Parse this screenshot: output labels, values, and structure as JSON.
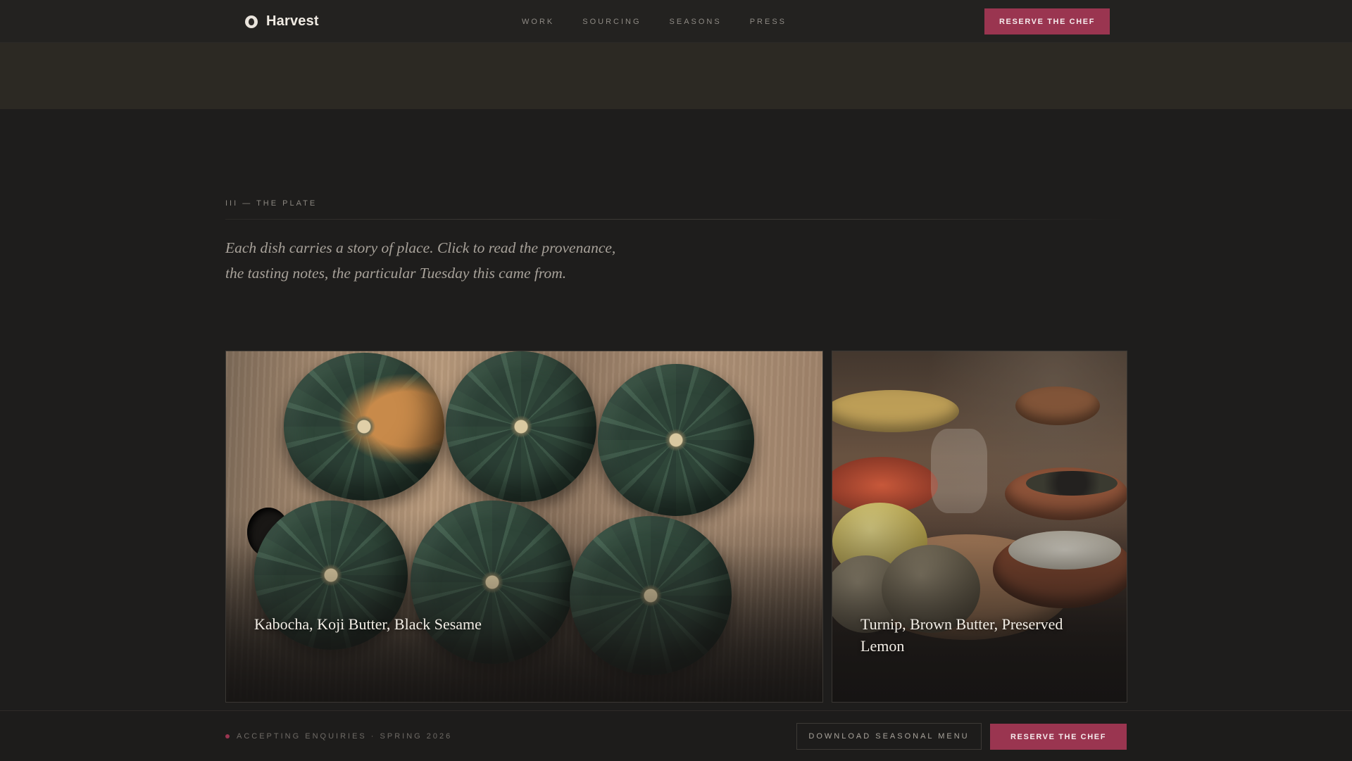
{
  "brand": {
    "name": "Harvest",
    "logo_icon": "globe-seal-icon"
  },
  "nav": {
    "items": [
      {
        "label": "WORK"
      },
      {
        "label": "SOURCING"
      },
      {
        "label": "SEASONS"
      },
      {
        "label": "PRESS"
      }
    ],
    "cta_label": "RESERVE THE CHEF"
  },
  "section": {
    "eyebrow": "III — THE PLATE",
    "intro": "Each dish carries a story of place. Click to read the provenance, the tasting notes, the particular Tuesday this came from."
  },
  "dishes": [
    {
      "title": "Kabocha, Koji Butter, Black Sesame",
      "photo": "kabocha squashes on a wooden board"
    },
    {
      "title": "Turnip, Brown Butter, Preserved Lemon",
      "photo": "turnips and bowls on a table"
    }
  ],
  "footer_bar": {
    "status": "ACCEPTING ENQUIRIES · SPRING 2026",
    "download_label": "DOWNLOAD SEASONAL MENU",
    "cta_label": "RESERVE THE CHEF"
  },
  "colors": {
    "background": "#1e1d1c",
    "accent": "#9a3550",
    "band": "#2c2923",
    "text_muted": "#8e8a84"
  }
}
